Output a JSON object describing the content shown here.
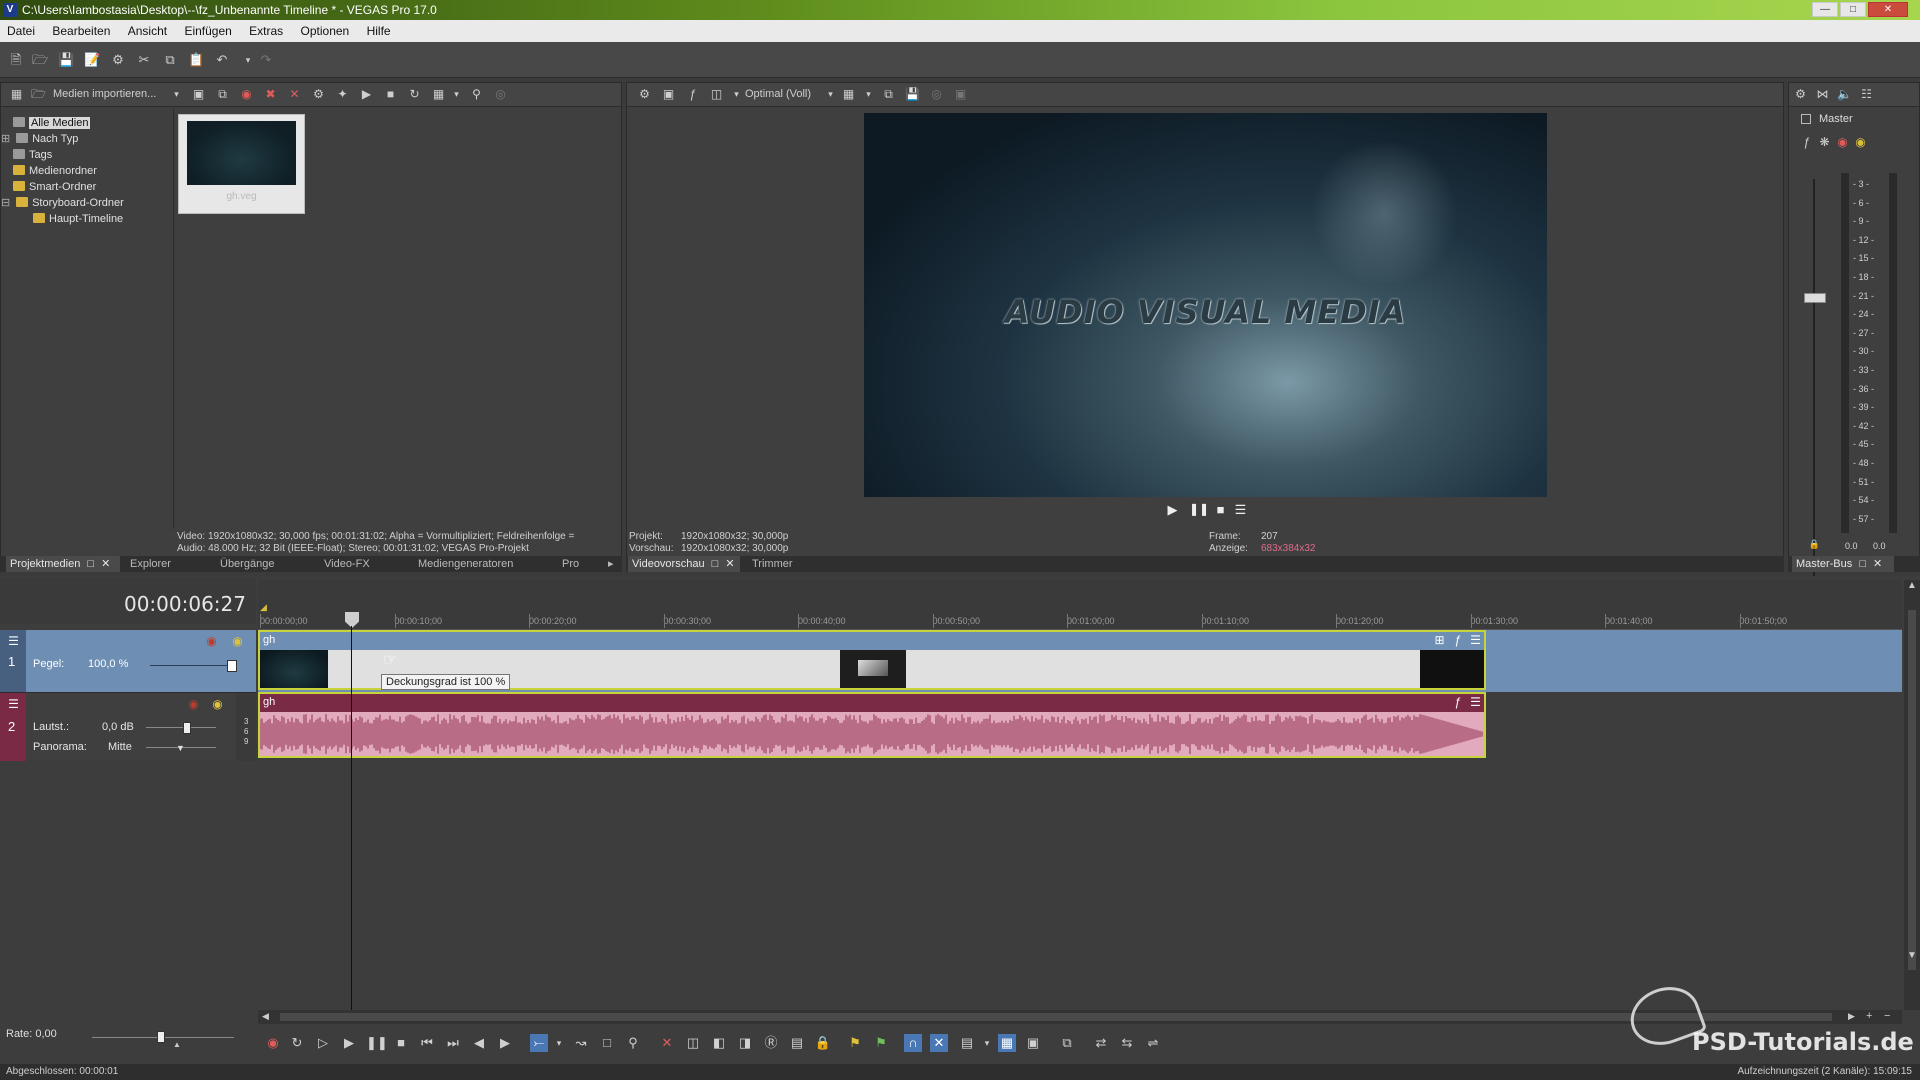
{
  "window": {
    "title": "C:\\Users\\Iambostasia\\Desktop\\--\\fz_Unbenannte Timeline * - VEGAS Pro 17.0",
    "app_icon": "V",
    "controls": [
      "minimize-icon",
      "maximize-icon",
      "close-icon"
    ]
  },
  "menu": [
    "Datei",
    "Bearbeiten",
    "Ansicht",
    "Einfügen",
    "Extras",
    "Optionen",
    "Hilfe"
  ],
  "media_panel": {
    "import_label": "Medien importieren...",
    "tree": [
      {
        "label": "Alle Medien",
        "selected": true
      },
      {
        "label": "Nach Typ"
      },
      {
        "label": "Tags"
      },
      {
        "label": "Medienordner"
      },
      {
        "label": "Smart-Ordner"
      },
      {
        "label": "Storyboard-Ordner"
      },
      {
        "label": "Haupt-Timeline"
      }
    ],
    "thumb_label": "gh.veg",
    "info_video": "Video: 1920x1080x32; 30,000 fps; 00:01:31:02; Alpha = Vormultipliziert; Feldreihenfolge =",
    "info_audio": "Audio: 48.000 Hz; 32 Bit (IEEE-Float); Stereo; 00:01:31:02; VEGAS Pro-Projekt",
    "tabs": [
      "Projektmedien",
      "Explorer",
      "Übergänge",
      "Video-FX",
      "Mediengeneratoren",
      "Pro"
    ]
  },
  "preview": {
    "quality": "Optimal (Voll)",
    "overlay_text": "AUDIO VISUAL MEDIA",
    "projekt_label": "Projekt:",
    "projekt_value": "1920x1080x32; 30,000p",
    "vorschau_label": "Vorschau:",
    "vorschau_value": "1920x1080x32; 30,000p",
    "frame_label": "Frame:",
    "frame_value": "207",
    "anzeige_label": "Anzeige:",
    "anzeige_value": "683x384x32",
    "tabs": [
      "Videovorschau",
      "Trimmer"
    ]
  },
  "master": {
    "label": "Master",
    "scale": [
      "3",
      "6",
      "9",
      "12",
      "15",
      "18",
      "21",
      "24",
      "27",
      "30",
      "33",
      "36",
      "39",
      "42",
      "45",
      "48",
      "51",
      "54",
      "57"
    ],
    "left_value": "0.0",
    "right_value": "0.0",
    "tab": "Master-Bus"
  },
  "timeline": {
    "timecode": "00:00:06:27",
    "ruler": [
      "00:00:00;00",
      "00:00:10;00",
      "00:00:20;00",
      "00:00:30;00",
      "00:00:40;00",
      "00:00:50;00",
      "00:01:00;00",
      "00:01:10;00",
      "00:01:20;00",
      "00:01:30;00",
      "00:01:40;00",
      "00:01:50;00"
    ],
    "video_track": {
      "number": "1",
      "pegel_label": "Pegel:",
      "pegel_value": "100,0 %",
      "clip_name": "gh",
      "tooltip": "Deckungsgrad ist 100 %"
    },
    "audio_track": {
      "number": "2",
      "volume_label": "Lautst.:",
      "volume_value": "0,0 dB",
      "pan_label": "Panorama:",
      "pan_value": "Mitte",
      "clip_name": "gh",
      "scale": [
        "3",
        "6",
        "9"
      ]
    },
    "rate_label": "Rate: 0,00"
  },
  "status": {
    "left": "Abgeschlossen: 00:00:01",
    "right": "Aufzeichnungszeit (2 Kanäle): 15:09:15"
  },
  "watermark": "PSD-Tutorials.de",
  "colors": {
    "video_track_bg": "#6e8fb3",
    "audio_track_bg": "#7a2a45",
    "audio_wave": "#d58ca6",
    "selection_yellow": "#c7d33b"
  }
}
